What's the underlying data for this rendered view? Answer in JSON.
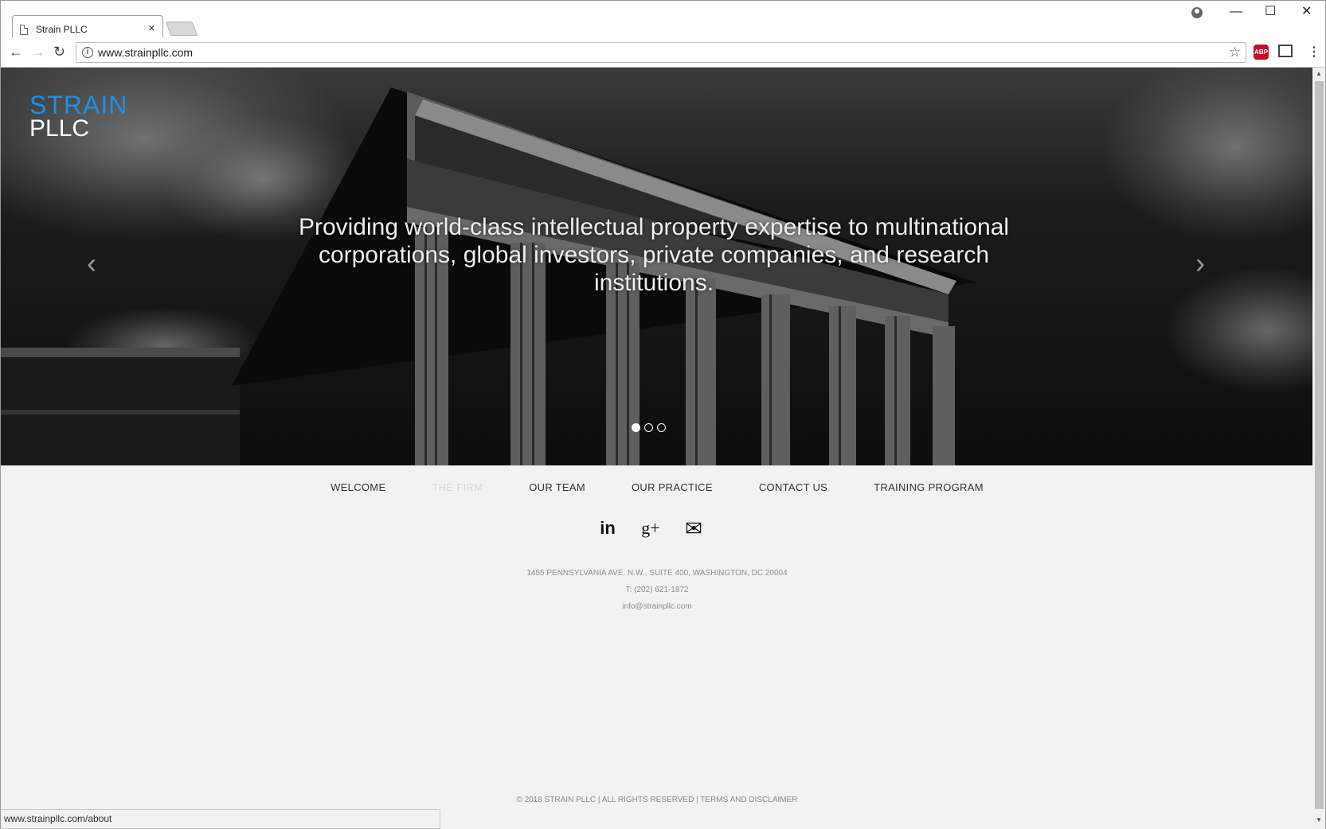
{
  "browser": {
    "tab_title": "Strain PLLC",
    "tab_close": "×",
    "url": "www.strainpllc.com",
    "status_url": "www.strainpllc.com/about",
    "abp_label": "ABP",
    "win_minimize": "—",
    "win_maximize": "☐",
    "win_close": "✕"
  },
  "logo": {
    "line1": "STRAIN",
    "line2": "PLLC"
  },
  "hero": {
    "text": "Providing world-class intellectual property expertise to multinational corporations, global investors, private companies, and research institutions."
  },
  "nav": [
    {
      "label": "WELCOME"
    },
    {
      "label": "THE FIRM"
    },
    {
      "label": "OUR TEAM"
    },
    {
      "label": "OUR PRACTICE"
    },
    {
      "label": "CONTACT US"
    },
    {
      "label": "TRAINING PROGRAM"
    }
  ],
  "social": {
    "linkedin": "in",
    "googleplus": "g+",
    "email": "✉"
  },
  "contact": {
    "address": "1455 PENNSYLVANIA AVE. N.W., SUITE 400, WASHINGTON, DC 20004",
    "phone": "T: (202) 621-1872",
    "email": "info@strainpllc.com"
  },
  "footer": {
    "copyright": "© 2018 STRAIN PLLC | ALL RIGHTS RESERVED | TERMS AND DISCLAIMER"
  },
  "carousel": {
    "slide_count": 3,
    "active_slide": 1
  }
}
